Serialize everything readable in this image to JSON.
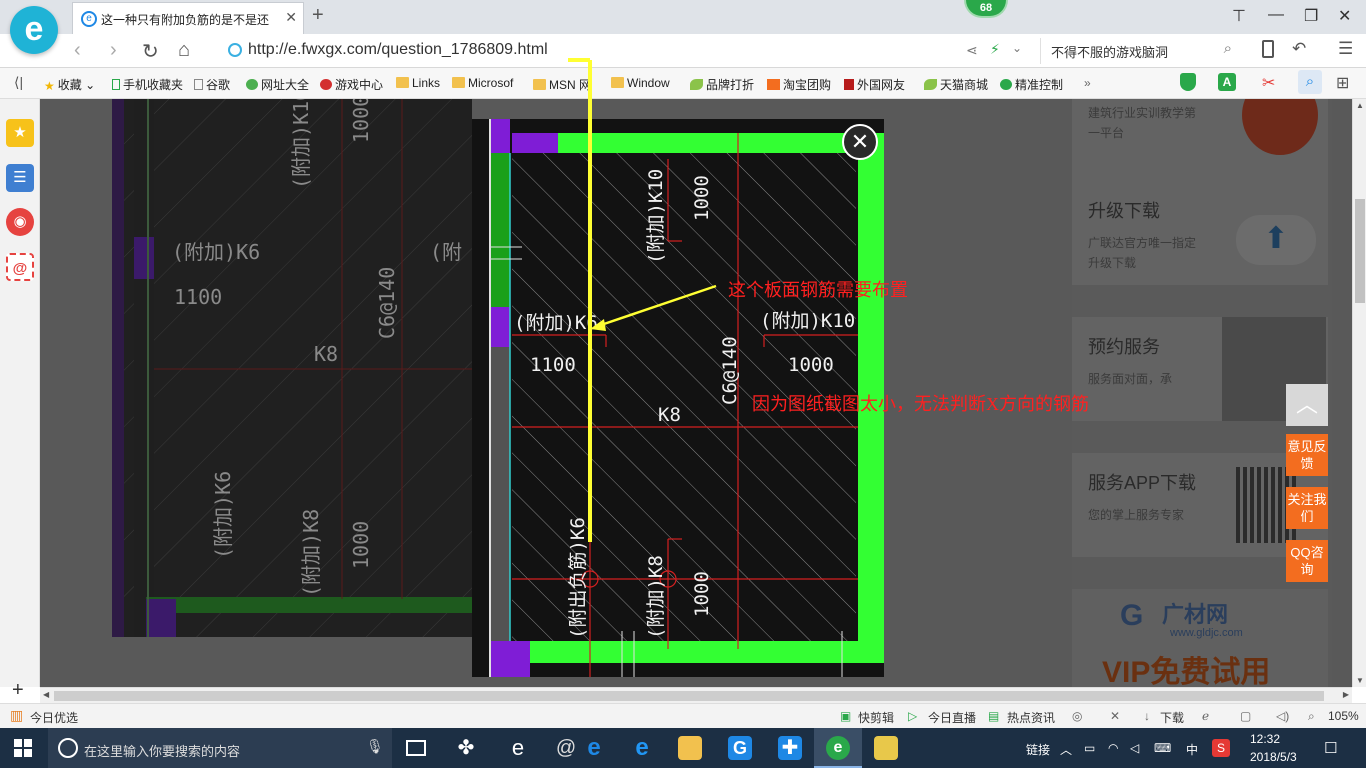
{
  "browser": {
    "tab_title": "这一种只有附加负筋的是不是还",
    "badge_count": "68",
    "url": "http://e.fwxgx.com/question_1786809.html",
    "search_text": "不得不服的游戏脑洞"
  },
  "bookmarks": [
    "收藏",
    "手机收藏夹",
    "谷歌",
    "网址大全",
    "游戏中心",
    "Links",
    "Microsof",
    "MSN 网",
    "Window",
    "品牌打折",
    "淘宝团购",
    "外国网友",
    "天猫商城",
    "精准控制"
  ],
  "right_column": {
    "top_card_desc": "建筑行业实训教学第一平台",
    "cards": [
      {
        "title": "升级下载",
        "desc": "广联达官方唯一指定升级下载"
      },
      {
        "title": "预约服务",
        "desc": "服务面对面，承"
      },
      {
        "title": "服务APP下载",
        "desc": "您的掌上服务专家"
      }
    ],
    "ad_brand": "广材网",
    "ad_url": "www.gldjc.com",
    "ad_banner": "VIP免费试用"
  },
  "side_buttons": {
    "feedback": "意见反馈",
    "follow": "关注我们",
    "qq": "QQ咨询"
  },
  "cad": {
    "labels_bg": [
      "(附加)K6",
      "1100",
      "K8",
      "C6@140",
      "(附加)K10",
      "1000",
      "(附加)K6",
      "(附加)K8",
      "1000",
      "(附"
    ],
    "labels_popup": [
      "(附加)K10",
      "1000",
      "(附加)K6",
      "1100",
      "(附加)K10",
      "1000",
      "K8",
      "C6@140",
      "(附出负筋)K6",
      "(附加)K8",
      "1000"
    ],
    "annotation_1": "这个板面钢筋需要布置",
    "annotation_2": "因为图纸截图太小，无法判断X方向的钢筋"
  },
  "status": {
    "left": "今日优选",
    "items": [
      "快剪辑",
      "今日直播",
      "热点资讯",
      "下载"
    ],
    "zoom": "105%"
  },
  "taskbar": {
    "search_placeholder": "在这里输入你要搜索的内容",
    "tray_link": "链接",
    "ime": "中",
    "time": "12:32",
    "date": "2018/5/3"
  },
  "colors": {
    "highlight_green": "#33ff33",
    "annotation_red": "#ff2020",
    "arrow_yellow": "#ffff33",
    "accent_orange": "#f36d1f"
  }
}
